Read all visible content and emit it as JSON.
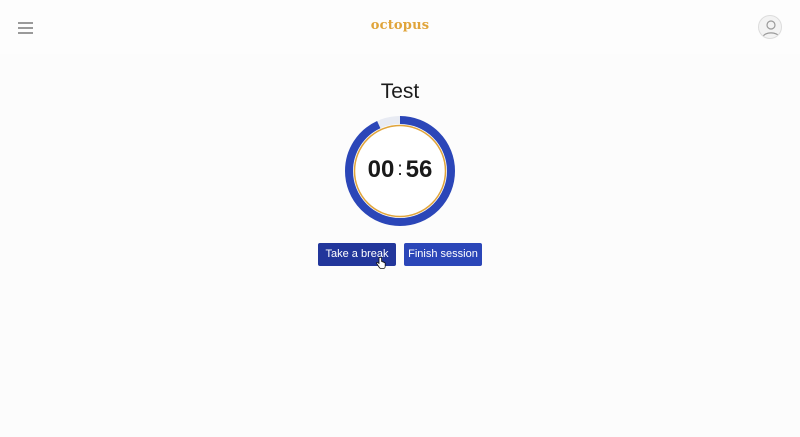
{
  "header": {
    "brand": "octopus",
    "menu_icon": "hamburger-menu-icon",
    "avatar_icon": "user-avatar-icon"
  },
  "session": {
    "title": "Test",
    "minutes": "00",
    "separator": ":",
    "seconds": "56",
    "remaining_fraction": 0.93
  },
  "actions": {
    "break_label": "Take a break",
    "finish_label": "Finish session"
  },
  "colors": {
    "brand": "#e0a43a",
    "progress": "#2b46b8",
    "track": "#e8ebf3",
    "inner_ring": "#e0a43a",
    "break_button": "#22369b",
    "finish_button": "#2b46b8"
  }
}
